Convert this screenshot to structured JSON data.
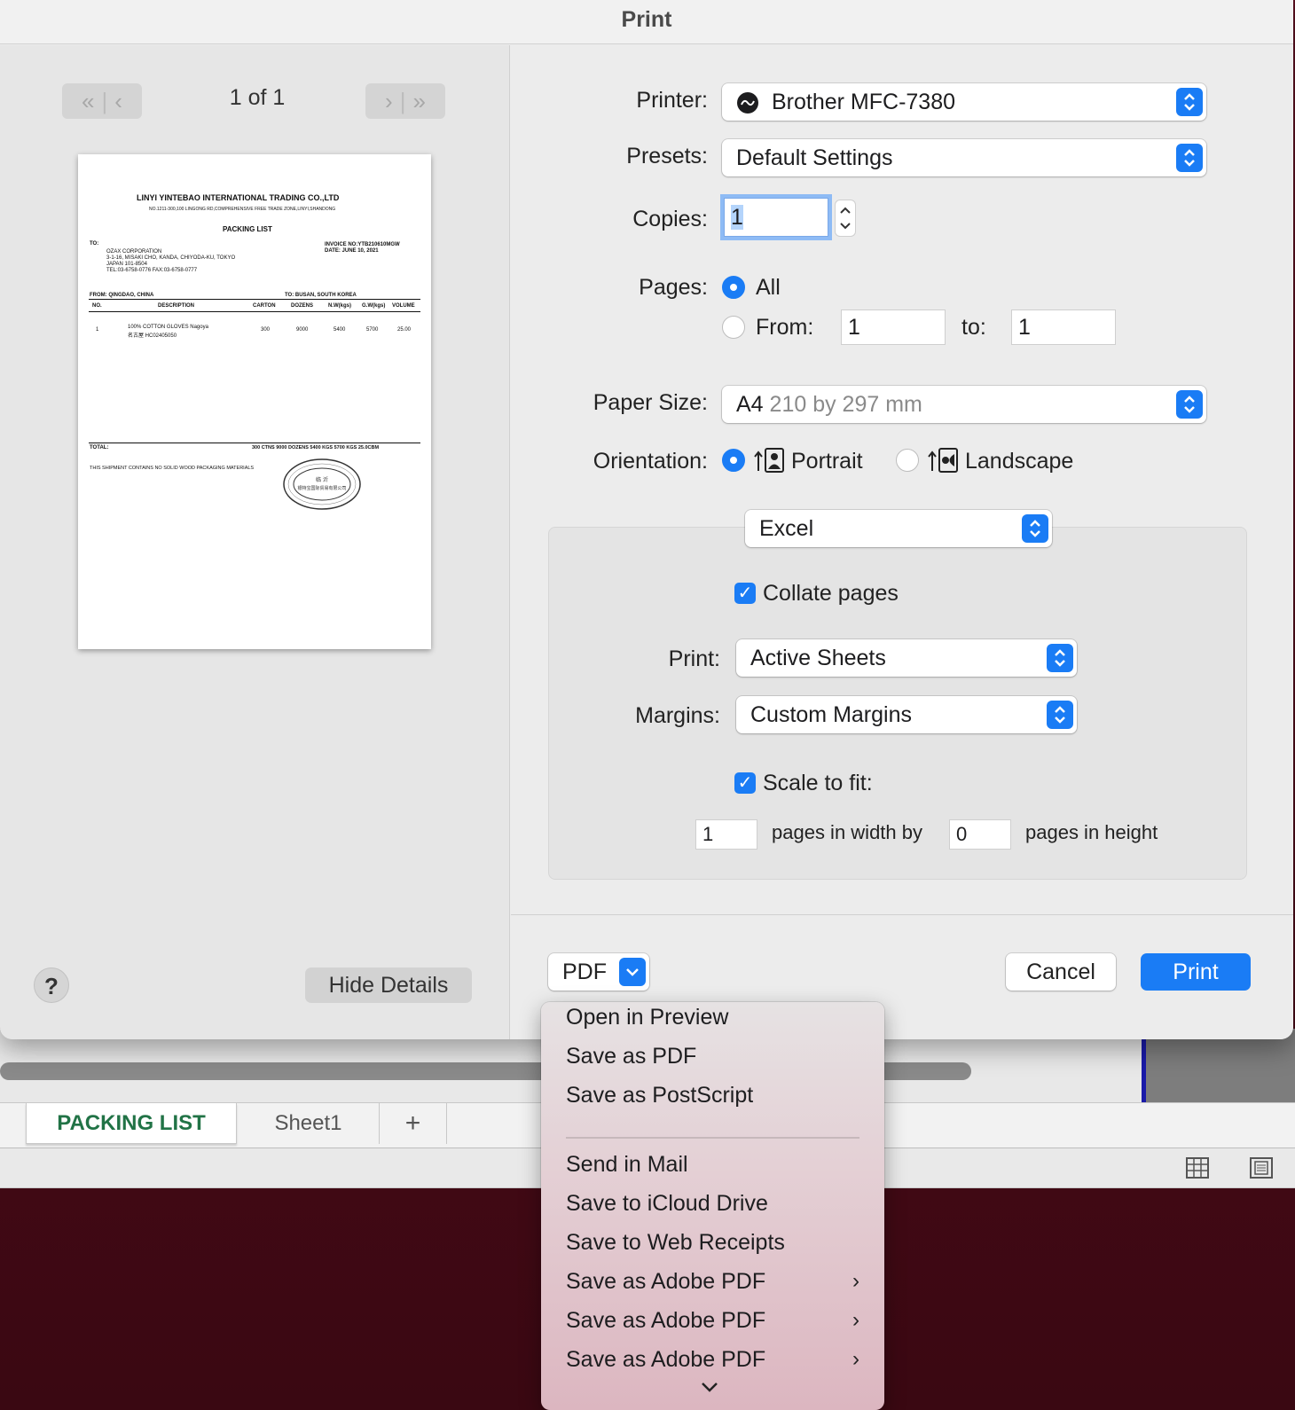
{
  "dialog": {
    "title": "Print",
    "preview": {
      "page_counter": "1 of 1",
      "doc": {
        "company": "LINYI YINTEBAO INTERNATIONAL TRADING CO.,LTD",
        "address": "NO.1211-300,100 LINGONG RD,COMPREHENSIVE FREE TRADE ZONE,LINYI,SHANDONG",
        "title": "PACKING LIST",
        "to_label": "TO:",
        "consignee_1": "OZAX CORPORATION",
        "consignee_2": "3-1-16, MISAKI CHO, KANDA, CHIYODA-KU, TOKYO",
        "consignee_3": "JAPAN 101-8504",
        "consignee_4": "TEL:03-6758-0776     FAX:03-6758-0777",
        "invoice_no": "INVOICE NO:YTB210610MGW",
        "date": "DATE: JUNE 10, 2021",
        "from": "FROM: QINGDAO, CHINA",
        "to_port": "TO: BUSAN, SOUTH KOREA",
        "headers": [
          "NO.",
          "DESCRIPTION",
          "CARTON",
          "DOZENS",
          "N.W(kgs)",
          "G.W(kgs)",
          "VOLUME"
        ],
        "row": [
          "1",
          "100% COTTON GLOVES Nagoya",
          "300",
          "9000",
          "5400",
          "5700",
          "25.00"
        ],
        "row_desc_2": "名古屋 HC02405050",
        "total_label": "TOTAL:",
        "totals": "300 CTNS    9000 DOZENS    5400 KGS    5700 KGS    25.0CBM",
        "note": "THIS SHIPMENT CONTAINS NO SOLID WOOD PACKAGING MATERIALS",
        "stamp_text": "Linyi Yintebao International Trading Co.,Ltd",
        "stamp_center": "临沂 银特宝国际贸易有限公司"
      }
    },
    "help_label": "?",
    "hide_details_label": "Hide Details",
    "printer": {
      "label": "Printer:",
      "value": "Brother MFC-7380"
    },
    "presets": {
      "label": "Presets:",
      "value": "Default Settings"
    },
    "copies": {
      "label": "Copies:",
      "value": "1"
    },
    "pages": {
      "label": "Pages:",
      "all_label": "All",
      "from_label": "From:",
      "from_value": "1",
      "to_label": "to:",
      "to_value": "1"
    },
    "paper_size": {
      "label": "Paper Size:",
      "value": "A4",
      "detail": "210 by 297 mm"
    },
    "orientation": {
      "label": "Orientation:",
      "portrait": "Portrait",
      "landscape": "Landscape"
    },
    "section_popup": "Excel",
    "collate": "Collate pages",
    "print_what": {
      "label": "Print:",
      "value": "Active Sheets"
    },
    "margins": {
      "label": "Margins:",
      "value": "Custom Margins"
    },
    "scale": {
      "label": "Scale to fit:",
      "width_value": "1",
      "width_text": "pages in width by",
      "height_value": "0",
      "height_text": "pages in height"
    },
    "pdf_label": "PDF",
    "cancel_label": "Cancel",
    "print_label": "Print"
  },
  "pdf_menu": {
    "group1": [
      "Open in Preview",
      "Save as PDF",
      "Save as PostScript"
    ],
    "group2": [
      "Send in Mail",
      "Save to iCloud Drive",
      "Save to Web Receipts",
      "Save as Adobe PDF",
      "Save as Adobe PDF",
      "Save as Adobe PDF"
    ]
  },
  "excel": {
    "tabs": [
      "PACKING LIST",
      "Sheet1",
      "+"
    ]
  },
  "colors": {
    "accent": "#1a7cf5",
    "excel_green": "#217346"
  }
}
